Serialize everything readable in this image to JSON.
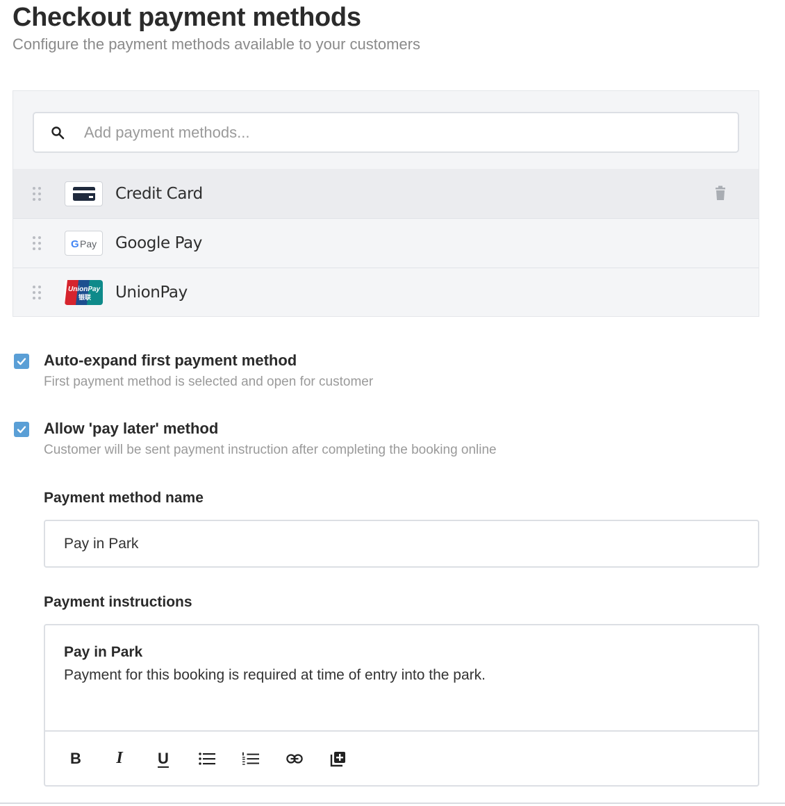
{
  "header": {
    "title": "Checkout payment methods",
    "subtitle": "Configure the payment methods available to your customers"
  },
  "search": {
    "placeholder": "Add payment methods...",
    "value": ""
  },
  "methods": [
    {
      "label": "Credit Card",
      "logo": "credit-card-logo",
      "active": true
    },
    {
      "label": "Google Pay",
      "logo": "google-pay-logo",
      "logo_text": "G Pay",
      "active": false
    },
    {
      "label": "UnionPay",
      "logo": "unionpay-logo",
      "logo_text": "UnionPay 银联",
      "active": false
    }
  ],
  "options": {
    "auto_expand": {
      "checked": true,
      "title": "Auto-expand first payment method",
      "description": "First payment method is selected and open for customer"
    },
    "pay_later": {
      "checked": true,
      "title": "Allow 'pay later' method",
      "description": "Customer will be sent payment instruction after completing the booking online"
    }
  },
  "method_name": {
    "label": "Payment method name",
    "value": "Pay in Park"
  },
  "instructions": {
    "label": "Payment instructions",
    "heading": "Pay in Park",
    "body": "Payment for this booking is required at time of entry into the park."
  },
  "toolbar": {
    "bold": "B",
    "italic": "I",
    "underline": "U",
    "icons": [
      "bold-icon",
      "italic-icon",
      "underline-icon",
      "bulleted-list-icon",
      "numbered-list-icon",
      "link-icon",
      "insert-block-icon"
    ]
  },
  "colors": {
    "accent": "#5a9fd6",
    "panel": "#f4f5f7",
    "active_row": "#ebecef"
  }
}
